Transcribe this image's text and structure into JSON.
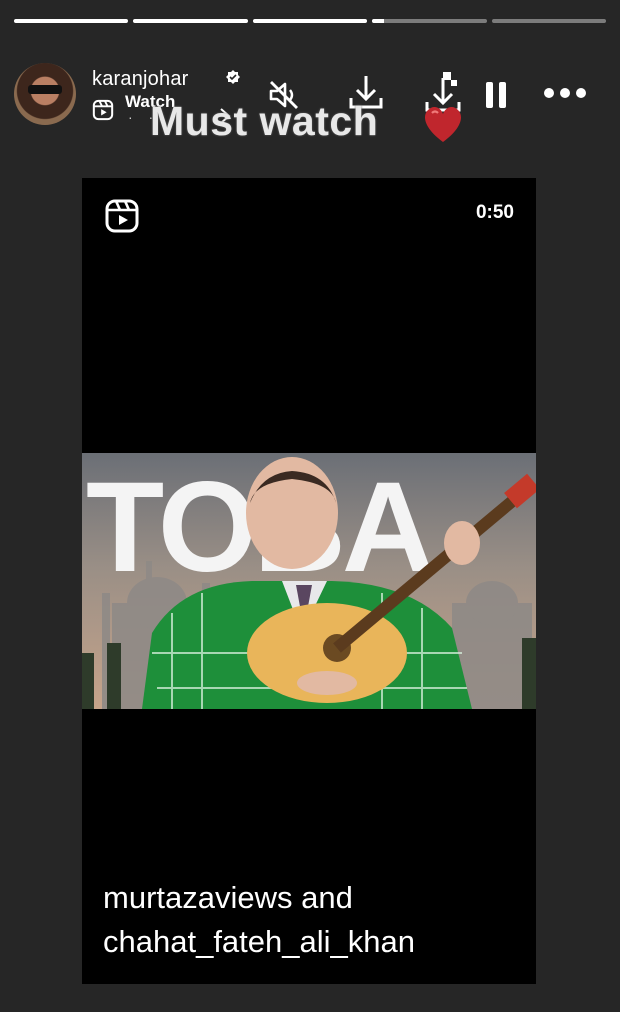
{
  "story": {
    "progress": [
      1,
      1,
      1,
      0.1,
      0
    ]
  },
  "header": {
    "username": "karanjohar",
    "music_label": "Watch",
    "icons": [
      "verified-icon",
      "reel-icon",
      "mute-icon",
      "download-icon",
      "sticker-download-icon",
      "pause-icon",
      "more-icon"
    ]
  },
  "caption": {
    "text": "Must watch",
    "emoji": "heart"
  },
  "video": {
    "duration": "0:50",
    "title_overlay": "TOBA",
    "credits_line1": "murtazaviews and",
    "credits_line2": "chahat_fateh_ali_khan"
  },
  "colors": {
    "background": "#262626",
    "video_bg": "#000000",
    "heart": "#c0262d",
    "jacket": "#1e8f3a"
  }
}
